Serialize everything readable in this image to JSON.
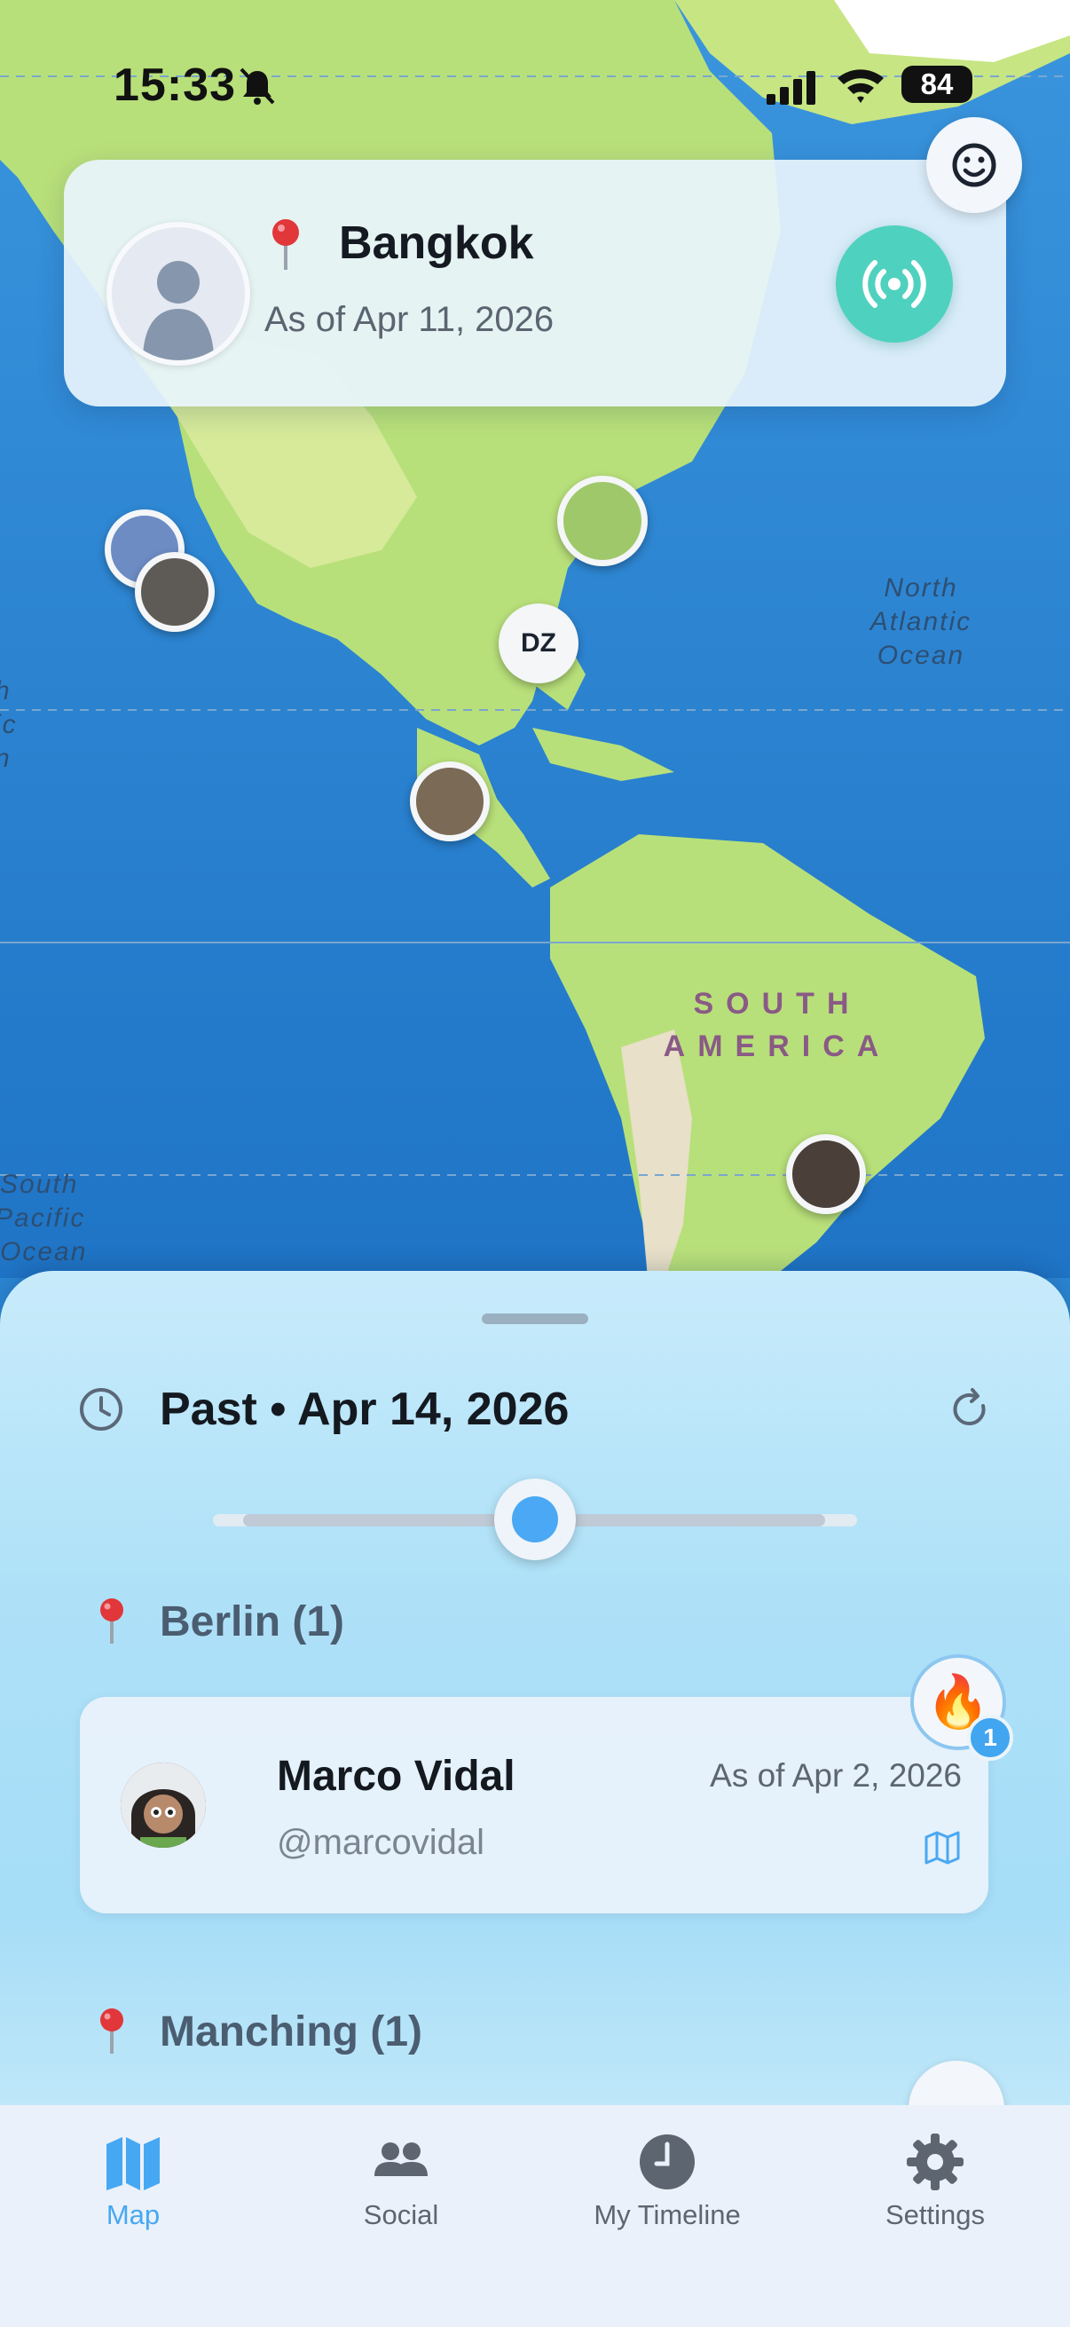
{
  "status_bar": {
    "time": "15:33",
    "battery": "84",
    "icons": [
      "bell-slash-icon",
      "cellular-signal-icon",
      "wifi-icon",
      "battery-icon"
    ]
  },
  "location_card": {
    "city": "Bangkok",
    "as_of": "As of Apr 11, 2026",
    "pin_icon": "map-pin-icon",
    "action_icon": "broadcast-icon"
  },
  "map": {
    "labels": {
      "north_atlantic": [
        "North",
        "Atlantic",
        "Ocean"
      ],
      "south_america": [
        "SOUTH",
        "AMERICA"
      ],
      "south_pacific": [
        "South",
        "Pacific",
        "Ocean"
      ],
      "left_edge": [
        "h",
        "ic",
        "n"
      ]
    },
    "dz_marker": "DZ",
    "colors": {
      "ocean": "#2b86d4",
      "land": "#b8e07a",
      "accent": "#46a8f2",
      "broadcast": "#4fd1bf"
    }
  },
  "timeline": {
    "period": "Past • Apr 14, 2026",
    "slider_position": 0.5
  },
  "groups": [
    {
      "title": "Berlin (1)",
      "people": [
        {
          "name": "Marco Vidal",
          "handle": "@marcovidal",
          "as_of": "As of Apr 2, 2026",
          "reaction": "🔥",
          "reaction_count": "1"
        }
      ]
    },
    {
      "title": "Manching (1)",
      "people": []
    }
  ],
  "tabs": [
    {
      "label": "Map",
      "icon": "map-icon",
      "active": true
    },
    {
      "label": "Social",
      "icon": "people-icon",
      "active": false
    },
    {
      "label": "My Timeline",
      "icon": "clock-icon",
      "active": false
    },
    {
      "label": "Settings",
      "icon": "gear-icon",
      "active": false
    }
  ]
}
